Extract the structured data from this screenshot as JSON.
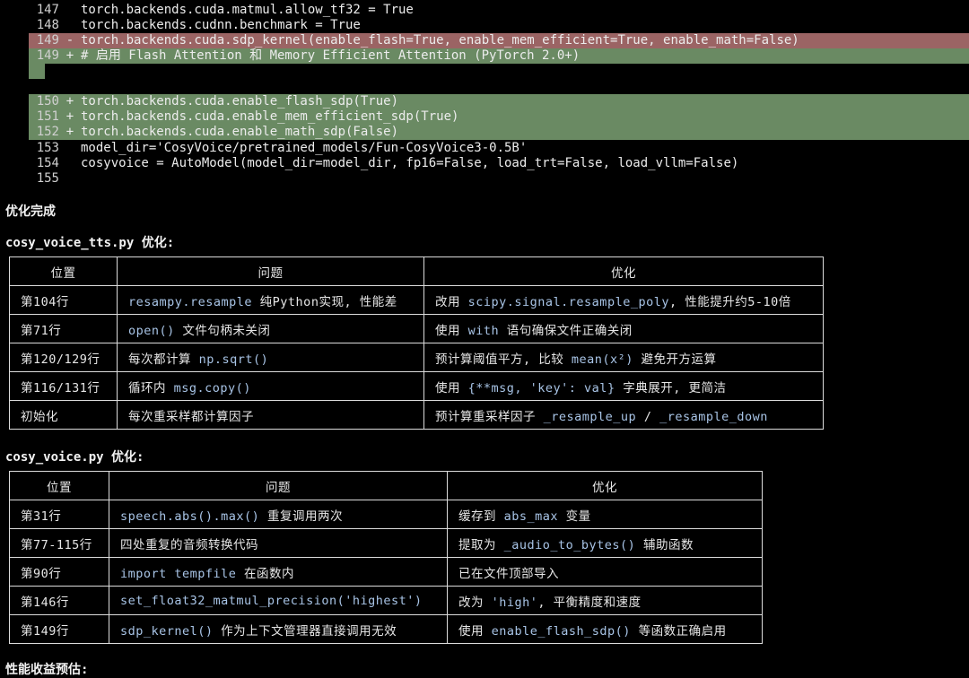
{
  "diff": {
    "lines": [
      {
        "num": "147",
        "mark": "",
        "text": "torch.backends.cuda.matmul.allow_tf32 = True",
        "kind": "ctx"
      },
      {
        "num": "148",
        "mark": "",
        "text": "torch.backends.cudnn.benchmark = True",
        "kind": "ctx"
      },
      {
        "num": "149",
        "mark": "-",
        "text": "torch.backends.cuda.sdp_kernel(enable_flash=True, enable_mem_efficient=True, enable_math=False)",
        "kind": "del"
      },
      {
        "num": "149",
        "mark": "+",
        "text": "# 启用 Flash Attention 和 Memory Efficient Attention (PyTorch 2.0+)",
        "kind": "add"
      },
      {
        "num": "150",
        "mark": "+",
        "text": "torch.backends.cuda.enable_flash_sdp(True)",
        "kind": "add"
      },
      {
        "num": "151",
        "mark": "+",
        "text": "torch.backends.cuda.enable_mem_efficient_sdp(True)",
        "kind": "add"
      },
      {
        "num": "152",
        "mark": "+",
        "text": "torch.backends.cuda.enable_math_sdp(False)",
        "kind": "add"
      },
      {
        "num": "153",
        "mark": "",
        "text": "model_dir='CosyVoice/pretrained_models/Fun-CosyVoice3-0.5B'",
        "kind": "ctx"
      },
      {
        "num": "154",
        "mark": "",
        "text": "cosyvoice = AutoModel(model_dir=model_dir, fp16=False, load_trt=False, load_vllm=False)",
        "kind": "ctx"
      },
      {
        "num": "155",
        "mark": "",
        "text": "",
        "kind": "ctx"
      }
    ]
  },
  "headings": {
    "done": "优化完成",
    "tts": "cosy_voice_tts.py 优化:",
    "voice": "cosy_voice.py 优化:",
    "next": "性能收益预估:"
  },
  "table1": {
    "headers": [
      "位置",
      "问题",
      "优化"
    ],
    "rows": [
      [
        [
          {
            "t": "第104行"
          }
        ],
        [
          {
            "t": "resampy.resample",
            "c": 1
          },
          {
            "t": " 纯Python实现, 性能差"
          }
        ],
        [
          {
            "t": "改用 "
          },
          {
            "t": "scipy.signal.resample_poly",
            "c": 1
          },
          {
            "t": ", 性能提升约5-10倍"
          }
        ]
      ],
      [
        [
          {
            "t": "第71行"
          }
        ],
        [
          {
            "t": "open()",
            "c": 1
          },
          {
            "t": " 文件句柄未关闭"
          }
        ],
        [
          {
            "t": "使用 "
          },
          {
            "t": "with",
            "c": 1
          },
          {
            "t": " 语句确保文件正确关闭"
          }
        ]
      ],
      [
        [
          {
            "t": "第120/129行"
          }
        ],
        [
          {
            "t": "每次都计算 "
          },
          {
            "t": "np.sqrt()",
            "c": 1
          }
        ],
        [
          {
            "t": "预计算阈值平方, 比较 "
          },
          {
            "t": "mean(x²)",
            "c": 1
          },
          {
            "t": " 避免开方运算"
          }
        ]
      ],
      [
        [
          {
            "t": "第116/131行"
          }
        ],
        [
          {
            "t": "循环内 "
          },
          {
            "t": "msg.copy()",
            "c": 1
          }
        ],
        [
          {
            "t": "使用 "
          },
          {
            "t": "{**msg, 'key': val}",
            "c": 1
          },
          {
            "t": " 字典展开, 更简洁"
          }
        ]
      ],
      [
        [
          {
            "t": "初始化"
          }
        ],
        [
          {
            "t": "每次重采样都计算因子"
          }
        ],
        [
          {
            "t": "预计算重采样因子 "
          },
          {
            "t": "_resample_up",
            "c": 1
          },
          {
            "t": " / "
          },
          {
            "t": "_resample_down",
            "c": 1
          }
        ]
      ]
    ]
  },
  "table2": {
    "headers": [
      "位置",
      "问题",
      "优化"
    ],
    "rows": [
      [
        [
          {
            "t": "第31行"
          }
        ],
        [
          {
            "t": "speech.abs().max()",
            "c": 1
          },
          {
            "t": " 重复调用两次"
          }
        ],
        [
          {
            "t": "缓存到 "
          },
          {
            "t": "abs_max",
            "c": 1
          },
          {
            "t": " 变量"
          }
        ]
      ],
      [
        [
          {
            "t": "第77-115行"
          }
        ],
        [
          {
            "t": "四处重复的音频转换代码"
          }
        ],
        [
          {
            "t": "提取为 "
          },
          {
            "t": "_audio_to_bytes()",
            "c": 1
          },
          {
            "t": " 辅助函数"
          }
        ]
      ],
      [
        [
          {
            "t": "第90行"
          }
        ],
        [
          {
            "t": "import tempfile",
            "c": 1
          },
          {
            "t": " 在函数内"
          }
        ],
        [
          {
            "t": "已在文件顶部导入"
          }
        ]
      ],
      [
        [
          {
            "t": "第146行"
          }
        ],
        [
          {
            "t": "set_float32_matmul_precision('highest')",
            "c": 1
          }
        ],
        [
          {
            "t": "改为 "
          },
          {
            "t": "'high'",
            "c": 1
          },
          {
            "t": ", 平衡精度和速度"
          }
        ]
      ],
      [
        [
          {
            "t": "第149行"
          }
        ],
        [
          {
            "t": "sdp_kernel()",
            "c": 1
          },
          {
            "t": " 作为上下文管理器直接调用无效"
          }
        ],
        [
          {
            "t": "使用 "
          },
          {
            "t": "enable_flash_sdp()",
            "c": 1
          },
          {
            "t": " 等函数正确启用"
          }
        ]
      ]
    ]
  },
  "colors": {
    "background": "#000000",
    "deleted_line": "#9b6464",
    "added_line": "#6a8a63",
    "inline_code": "#a8c4e6"
  }
}
